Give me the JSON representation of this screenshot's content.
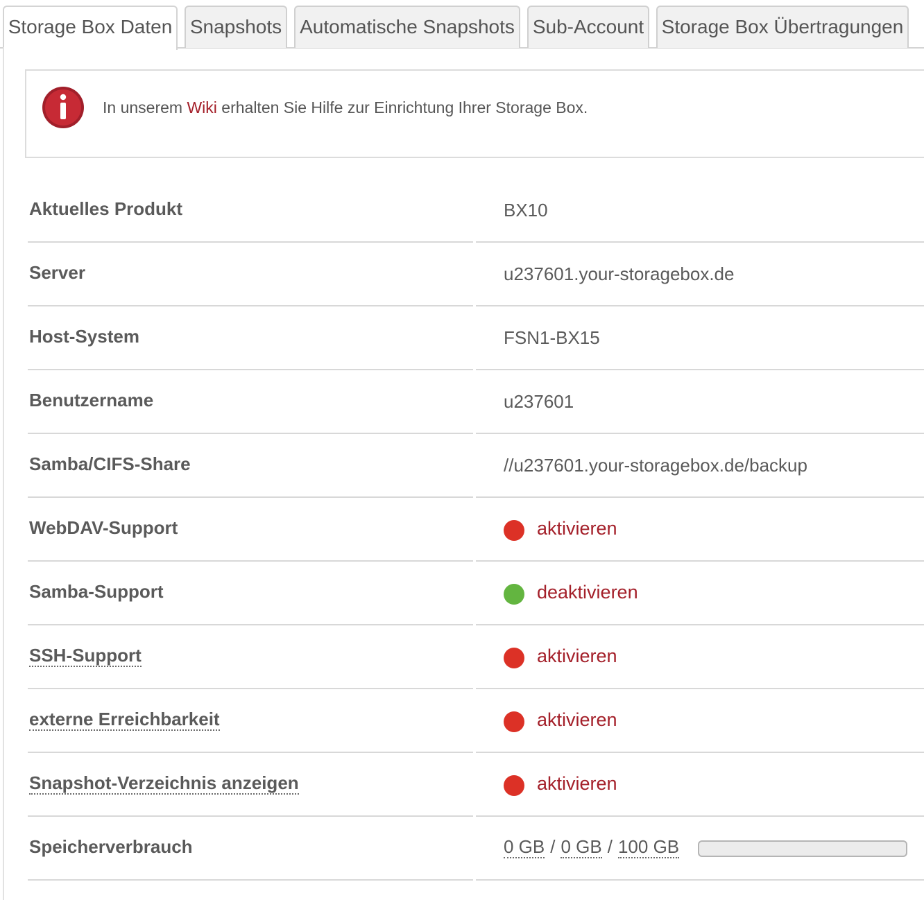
{
  "tabs": [
    {
      "label": "Storage Box Daten",
      "active": true
    },
    {
      "label": "Snapshots",
      "active": false
    },
    {
      "label": "Automatische Snapshots",
      "active": false
    },
    {
      "label": "Sub-Account",
      "active": false
    },
    {
      "label": "Storage Box Übertragungen",
      "active": false
    }
  ],
  "info": {
    "icon": "info-icon",
    "text_before": "In unserem ",
    "link": "Wiki",
    "text_after": " erhalten Sie Hilfe zur Einrichtung Ihrer Storage Box."
  },
  "colors": {
    "accent_red": "#a4202a",
    "status_on": "#63b540",
    "status_off": "#dc3126"
  },
  "rows": [
    {
      "label": "Aktuelles Produkt",
      "value": "BX10"
    },
    {
      "label": "Server",
      "value": "u237601.your-storagebox.de"
    },
    {
      "label": "Host-System",
      "value": "FSN1-BX15"
    },
    {
      "label": "Benutzername",
      "value": "u237601"
    },
    {
      "label": "Samba/CIFS-Share",
      "value": "//u237601.your-storagebox.de/backup"
    }
  ],
  "toggles": [
    {
      "label": "WebDAV-Support",
      "enabled": false,
      "action": "aktivieren"
    },
    {
      "label": "Samba-Support",
      "enabled": true,
      "action": "deaktivieren"
    },
    {
      "label": "SSH-Support",
      "enabled": false,
      "action": "aktivieren"
    },
    {
      "label": "externe Erreichbarkeit",
      "enabled": false,
      "action": "aktivieren"
    },
    {
      "label": "Snapshot-Verzeichnis anzeigen",
      "enabled": false,
      "action": "aktivieren"
    }
  ],
  "usage": {
    "label": "Speicherverbrauch",
    "used": "0 GB",
    "snapshots": "0 GB",
    "total": "100 GB",
    "separator": "/",
    "fraction": 0
  }
}
